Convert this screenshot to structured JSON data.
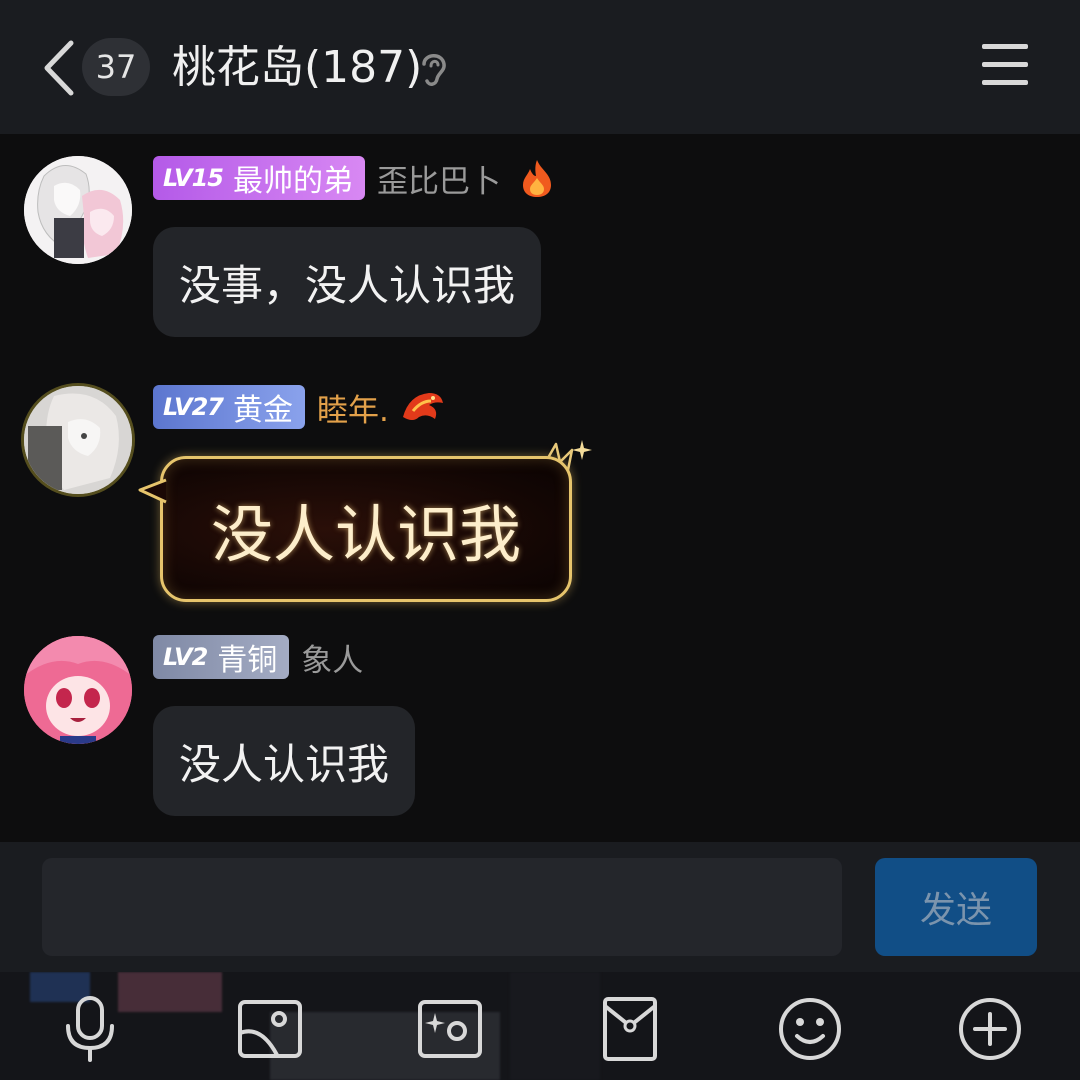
{
  "header": {
    "unread_count": "37",
    "title": "桃花岛(187)",
    "icons": {
      "back": "chevron-left-icon",
      "earpiece": "ear-icon",
      "menu": "hamburger-menu-icon"
    }
  },
  "messages": [
    {
      "level": "LV15",
      "badge_title": "最帅的弟",
      "badge_color": "#c46cf0",
      "nickname": "歪比巴卜",
      "nickname_color": "#9a9a9a",
      "decoration_icon": "fire-icon",
      "text": "没事，没人认识我"
    },
    {
      "level": "LV27",
      "badge_title": "黄金",
      "badge_color": "#6f86d8",
      "nickname": "睦年.",
      "nickname_color": "#e3a14a",
      "decoration_icon": "dragon-icon",
      "text": "没人认识我"
    },
    {
      "level": "LV2",
      "badge_title": "青铜",
      "badge_color": "#8a93ad",
      "nickname": "象人",
      "nickname_color": "#9a9a9a",
      "text": "没人认识我"
    }
  ],
  "input": {
    "value": "",
    "send_label": "发送",
    "send_color": "#114e86"
  },
  "toolbar": [
    "microphone-icon",
    "image-icon",
    "camera-icon",
    "red-packet-icon",
    "emoji-icon",
    "plus-icon"
  ]
}
